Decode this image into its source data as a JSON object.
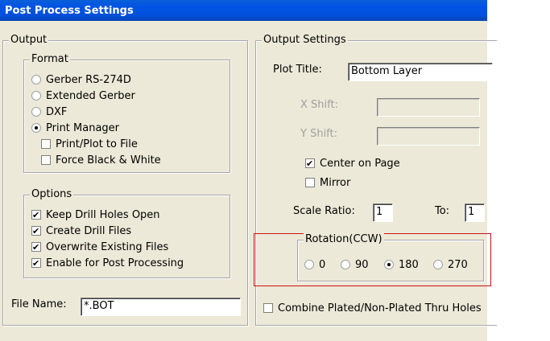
{
  "window": {
    "title": "Post Process Settings"
  },
  "output": {
    "label": "Output",
    "format": {
      "label": "Format",
      "options": [
        {
          "label": "Gerber RS-274D",
          "selected": false
        },
        {
          "label": "Extended Gerber",
          "selected": false
        },
        {
          "label": "DXF",
          "selected": false
        },
        {
          "label": "Print Manager",
          "selected": true
        }
      ],
      "print_to_file": {
        "label": "Print/Plot to File",
        "checked": false
      },
      "force_bw": {
        "label": "Force Black & White",
        "checked": false
      }
    },
    "options": {
      "label": "Options",
      "items": [
        {
          "label": "Keep Drill Holes Open",
          "checked": true
        },
        {
          "label": "Create Drill Files",
          "checked": true
        },
        {
          "label": "Overwrite Existing Files",
          "checked": true
        },
        {
          "label": "Enable for Post Processing",
          "checked": true
        }
      ]
    },
    "file_name": {
      "label": "File Name:",
      "value": "*.BOT"
    }
  },
  "settings": {
    "label": "Output Settings",
    "plot_title": {
      "label": "Plot Title:",
      "value": "Bottom Layer"
    },
    "x_shift": {
      "label": "X Shift:",
      "value": ""
    },
    "y_shift": {
      "label": "Y Shift:",
      "value": ""
    },
    "center_on_page": {
      "label": "Center on Page",
      "checked": true
    },
    "mirror": {
      "label": "Mirror",
      "checked": false
    },
    "scale": {
      "label": "Scale Ratio:",
      "value": "1",
      "to_label": "To:",
      "to_value": "1"
    },
    "rotation": {
      "label": "Rotation(CCW)",
      "options": [
        {
          "label": "0",
          "selected": false
        },
        {
          "label": "90",
          "selected": false
        },
        {
          "label": "180",
          "selected": true
        },
        {
          "label": "270",
          "selected": false
        }
      ]
    },
    "combine": {
      "label": "Combine Plated/Non-Plated Thru Holes",
      "checked": false
    }
  },
  "colors": {
    "titlebar": "#0054e3",
    "dialog_bg": "#ece9d8",
    "highlight": "#d01010"
  }
}
